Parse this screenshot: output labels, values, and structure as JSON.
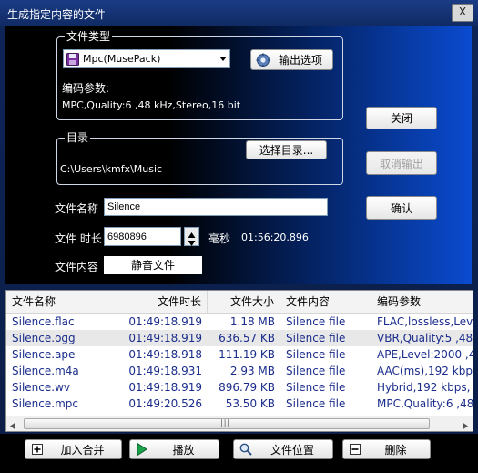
{
  "window": {
    "title": "生成指定内容的文件",
    "close_glyph": "X"
  },
  "file_type": {
    "group_label": "文件类型",
    "format_selected": "Mpc(MusePack)",
    "output_options_label": "输出选项",
    "encode_params_label": "编码参数:",
    "encode_params_value": "MPC,Quality:6 ,48   kHz,Stereo,16 bit"
  },
  "directory": {
    "group_label": "目录",
    "choose_label": "选择目录...",
    "path": "C:\\Users\\kmfx\\Music"
  },
  "buttons": {
    "close": "关闭",
    "cancel_output": "取消输出",
    "confirm": "确认"
  },
  "form": {
    "file_name_label": "文件名称",
    "file_name_value": "Silence",
    "duration_label": "文件 时长",
    "duration_value": "6980896",
    "duration_unit": "毫秒",
    "duration_readout": "01:56:20.896",
    "content_label": "文件内容",
    "content_value": "静音文件"
  },
  "table": {
    "columns": [
      "文件名称",
      "文件时长",
      "文件大小",
      "文件内容",
      "编码参数"
    ],
    "rows": [
      {
        "name": "Silence.flac",
        "duration": "01:49:18.919",
        "size": "1.18 MB",
        "content": "Silence file",
        "params": "FLAC,lossless,Level:"
      },
      {
        "name": "Silence.ogg",
        "duration": "01:49:18.919",
        "size": "636.57 KB",
        "content": "Silence file",
        "params": "VBR,Quality:5 ,48"
      },
      {
        "name": "Silence.ape",
        "duration": "01:49:18.918",
        "size": "111.19 KB",
        "content": "Silence file",
        "params": "APE,Level:2000   ,4"
      },
      {
        "name": "Silence.m4a",
        "duration": "01:49:18.931",
        "size": "2.93 MB",
        "content": "Silence file",
        "params": "AAC(ms),192    kbp"
      },
      {
        "name": "Silence.wv",
        "duration": "01:49:18.919",
        "size": "896.79 KB",
        "content": "Silence file",
        "params": "Hybrid,192    kbps,"
      },
      {
        "name": "Silence.mpc",
        "duration": "01:49:20.526",
        "size": "53.50 KB",
        "content": "Silence file",
        "params": "MPC,Quality:6 ,48"
      }
    ],
    "selected_row": 1
  },
  "bottom": {
    "add_merge": "加入合并",
    "play": "播放",
    "file_location": "文件位置",
    "delete": "删除"
  },
  "icons": {
    "format_icon": "floppy-disk-icon",
    "options_icon": "gear-icon",
    "spinner": "spin-up-down-icon",
    "add_icon": "plus-icon",
    "play_icon": "play-icon",
    "location_icon": "magnifier-icon",
    "delete_icon": "minus-icon"
  },
  "colors": {
    "accent_blue": "#0a4bd0",
    "row_text": "#1a2c8c",
    "play_green": "#1aa34a"
  }
}
